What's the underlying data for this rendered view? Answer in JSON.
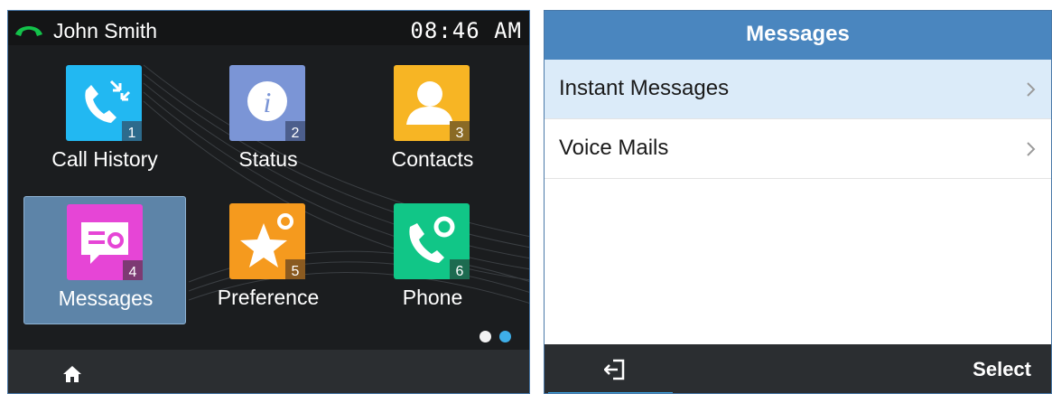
{
  "left_screen": {
    "status": {
      "user_name": "John Smith",
      "time": "08:46 AM",
      "line_icon": "handset-icon",
      "line_icon_color": "#13c24a"
    },
    "apps": [
      {
        "label": "Call History",
        "number": "1",
        "icon": "call-history-icon",
        "color": "#22b8f2",
        "selected": false
      },
      {
        "label": "Status",
        "number": "2",
        "icon": "info-icon",
        "color": "#7b95d6",
        "selected": false
      },
      {
        "label": "Contacts",
        "number": "3",
        "icon": "contact-person-icon",
        "color": "#f7b524",
        "selected": false
      },
      {
        "label": "Messages",
        "number": "4",
        "icon": "message-icon",
        "color": "#e645d6",
        "selected": true
      },
      {
        "label": "Preference",
        "number": "5",
        "icon": "star-gear-icon",
        "color": "#f59a1e",
        "selected": false
      },
      {
        "label": "Phone",
        "number": "6",
        "icon": "phone-gear-icon",
        "color": "#11c687",
        "selected": false
      }
    ],
    "pagination": {
      "pages": 2,
      "current": 2
    },
    "footer": {
      "home_icon": "home-icon"
    }
  },
  "right_screen": {
    "title": "Messages",
    "items": [
      {
        "label": "Instant Messages",
        "highlighted": true
      },
      {
        "label": "Voice Mails",
        "highlighted": false
      }
    ],
    "softkeys": {
      "back_icon": "exit-icon",
      "select_label": "Select"
    },
    "colors": {
      "title_bar": "#4a86bf",
      "highlight": "#dbebf9",
      "accent": "#3fa5e3"
    }
  }
}
